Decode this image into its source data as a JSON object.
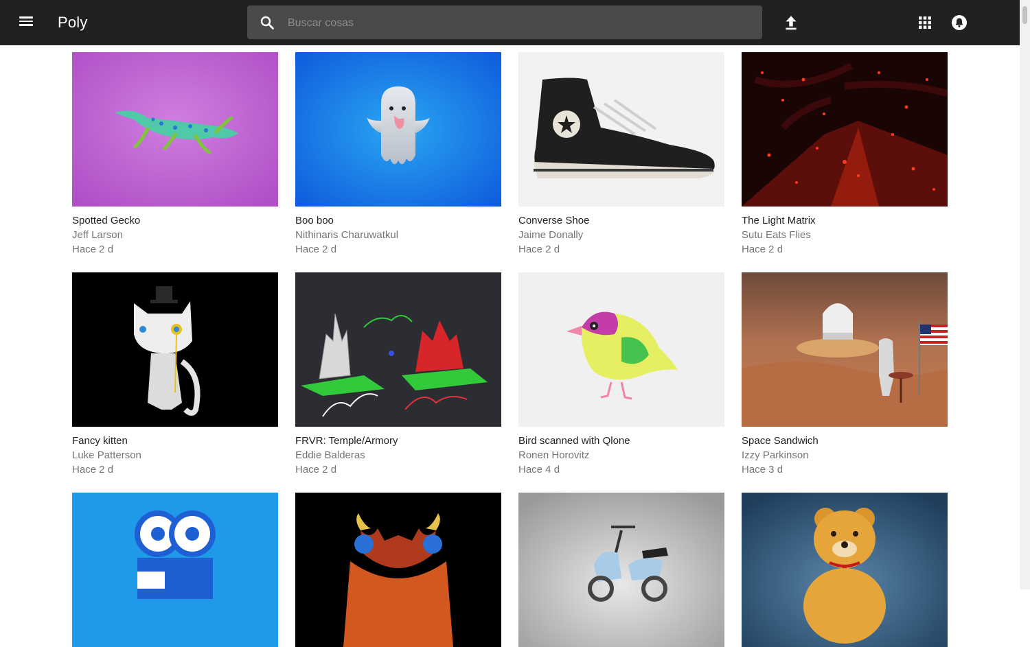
{
  "app": {
    "name": "Poly"
  },
  "search": {
    "placeholder": "Buscar cosas"
  },
  "icons": {
    "menu": "menu-icon",
    "search": "search-icon",
    "upload": "upload-icon",
    "apps": "apps-grid-icon",
    "account": "account-icon"
  },
  "colors": {
    "topbar": "#212121",
    "search_bg": "#4a4a4a",
    "title_text": "#212121",
    "meta_text": "#757575"
  },
  "items": [
    {
      "title": "Spotted Gecko",
      "author": "Jeff Larson",
      "time": "Hace 2 d"
    },
    {
      "title": "Boo boo",
      "author": "Nithinaris Charuwatkul",
      "time": "Hace 2 d"
    },
    {
      "title": "Converse Shoe",
      "author": "Jaime Donally",
      "time": "Hace 2 d"
    },
    {
      "title": "The Light Matrix",
      "author": "Sutu Eats Flies",
      "time": "Hace 2 d"
    },
    {
      "title": "Fancy kitten",
      "author": "Luke Patterson",
      "time": "Hace 2 d"
    },
    {
      "title": "FRVR: Temple/Armory",
      "author": "Eddie Balderas",
      "time": "Hace 2 d"
    },
    {
      "title": "Bird scanned with Qlone",
      "author": "Ronen Horovitz",
      "time": "Hace 4 d"
    },
    {
      "title": "Space Sandwich",
      "author": "Izzy Parkinson",
      "time": "Hace 3 d"
    },
    {
      "title": "",
      "author": "",
      "time": ""
    },
    {
      "title": "",
      "author": "",
      "time": ""
    },
    {
      "title": "",
      "author": "",
      "time": ""
    },
    {
      "title": "",
      "author": "",
      "time": ""
    }
  ]
}
